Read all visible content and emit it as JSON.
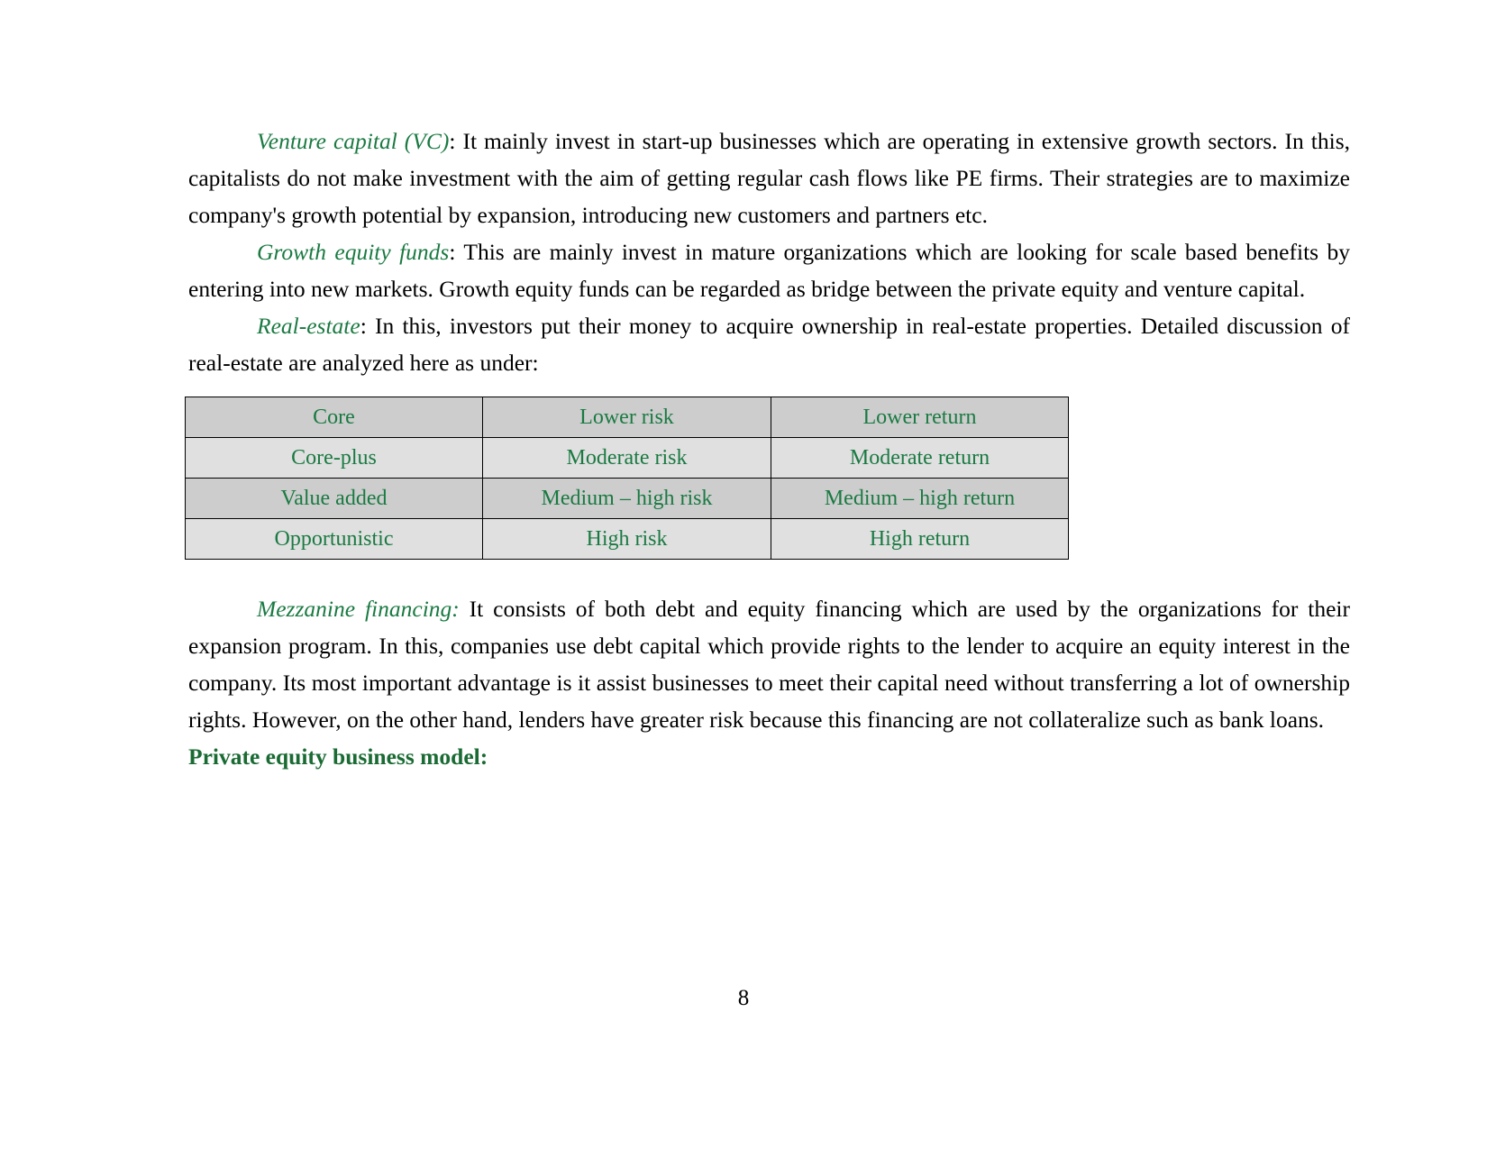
{
  "document": {
    "page_number": "8",
    "accent_green": "#1a7a42",
    "heading_green": "#1a6b33",
    "body_black": "#000000"
  },
  "paragraphs": [
    {
      "lead": "Venture capital (VC)",
      "body": ": It mainly invest in start-up businesses which are operating in extensive growth sectors. In this, capitalists do not make investment with the aim of getting regular cash flows like PE firms. Their strategies are to maximize company's growth potential by expansion, introducing new customers and partners etc.",
      "color": "black"
    },
    {
      "lead": "Growth equity funds",
      "body": ": This are mainly invest in mature organizations which are looking for scale based benefits by entering into new markets. Growth equity funds can be regarded as bridge between the private equity and venture capital.",
      "color": "black"
    },
    {
      "lead": "Real-estate",
      "body": ": In this, investors put their money to acquire ownership in real-estate properties. Detailed discussion of real-estate are analyzed here as under:",
      "color": "black"
    },
    {
      "lead": "Mezzanine financing:",
      "body": " It consists of both debt and equity financing which are used by the organizations for their expansion program. In this, companies use debt capital which provide rights to the lender to acquire an equity interest in the company. Its most important advantage is it assist businesses to meet their capital need without transferring a lot of ownership rights. However, on the other hand, lenders have greater risk because this financing are not collateralize such as bank loans.",
      "color": "green"
    }
  ],
  "table": {
    "rows": [
      {
        "type": "Core",
        "risk": "Lower risk",
        "return": "Lower return"
      },
      {
        "type": "Core-plus",
        "risk": "Moderate risk",
        "return": "Moderate return"
      },
      {
        "type": "Value added",
        "risk": "Medium – high risk",
        "return": "Medium – high return"
      },
      {
        "type": "Opportunistic",
        "risk": "High risk",
        "return": "High return"
      }
    ]
  },
  "section_heading": "Private equity business model:"
}
